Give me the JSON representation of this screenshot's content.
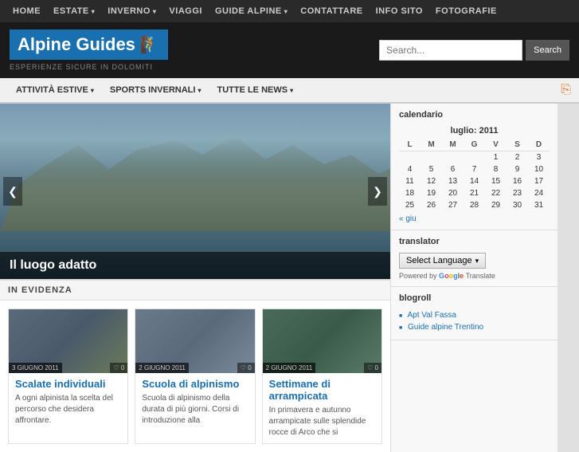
{
  "topNav": {
    "items": [
      {
        "label": "HOME",
        "hasDropdown": false
      },
      {
        "label": "ESTATE",
        "hasDropdown": true
      },
      {
        "label": "INVERNO",
        "hasDropdown": true
      },
      {
        "label": "VIAGGI",
        "hasDropdown": false
      },
      {
        "label": "GUIDE ALPINE",
        "hasDropdown": true
      },
      {
        "label": "CONTATTARE",
        "hasDropdown": false
      },
      {
        "label": "INFO SITO",
        "hasDropdown": false
      },
      {
        "label": "FOTOGRAFIE",
        "hasDropdown": false
      }
    ]
  },
  "header": {
    "logoText": "Alpine Guides",
    "tagline": "ESPERIENZE SICURE IN DOLOMITI",
    "search": {
      "placeholder": "Search...",
      "buttonLabel": "Search"
    }
  },
  "subNav": {
    "items": [
      {
        "label": "ATTIVITÀ ESTIVE",
        "hasDropdown": true
      },
      {
        "label": "SPORTS INVERNALI",
        "hasDropdown": true
      },
      {
        "label": "TUTTE LE NEWS",
        "hasDropdown": true
      }
    ]
  },
  "slider": {
    "caption": "Il luogo adatto"
  },
  "inEvidenza": {
    "title": "IN EVIDENZA",
    "cards": [
      {
        "date": "3 GIUGNO 2011",
        "comments": "0",
        "title": "Scalate individuali",
        "text": "A ogni alpinista la scelta del percorso che desidera affrontare."
      },
      {
        "date": "2 GIUGNO 2011",
        "comments": "0",
        "title": "Scuola di alpinismo",
        "text": "Scuola di alpinismo della durata di più giorni. Corsi di introduzione alla"
      },
      {
        "date": "2 GIUGNO 2011",
        "comments": "0",
        "title": "Settimane di arrampicata",
        "text": "In primavera e autunno arrampicate sulle splendide rocce di Arco che si"
      }
    ]
  },
  "sidebar": {
    "calendar": {
      "sectionTitle": "calendario",
      "monthTitle": "luglio: 2011",
      "headers": [
        "L",
        "M",
        "M",
        "G",
        "V",
        "S",
        "D"
      ],
      "weeks": [
        [
          "",
          "",
          "",
          "",
          "1",
          "2",
          "3"
        ],
        [
          "4",
          "5",
          "6",
          "7",
          "8",
          "9",
          "10"
        ],
        [
          "11",
          "12",
          "13",
          "14",
          "15",
          "16",
          "17"
        ],
        [
          "18",
          "19",
          "20",
          "21",
          "22",
          "23",
          "24"
        ],
        [
          "25",
          "26",
          "27",
          "28",
          "29",
          "30",
          "31"
        ]
      ],
      "prevLink": "« giu"
    },
    "translator": {
      "sectionTitle": "Translator",
      "selectLabel": "Select Language",
      "poweredByLabel": "Powered by",
      "googleLabel": "Google",
      "translateLabel": "Translate"
    },
    "blogroll": {
      "sectionTitle": "Blogroll",
      "links": [
        {
          "label": "Apt Val Fassa",
          "url": "#"
        },
        {
          "label": "Guide alpine Trentino",
          "url": "#"
        }
      ]
    }
  }
}
